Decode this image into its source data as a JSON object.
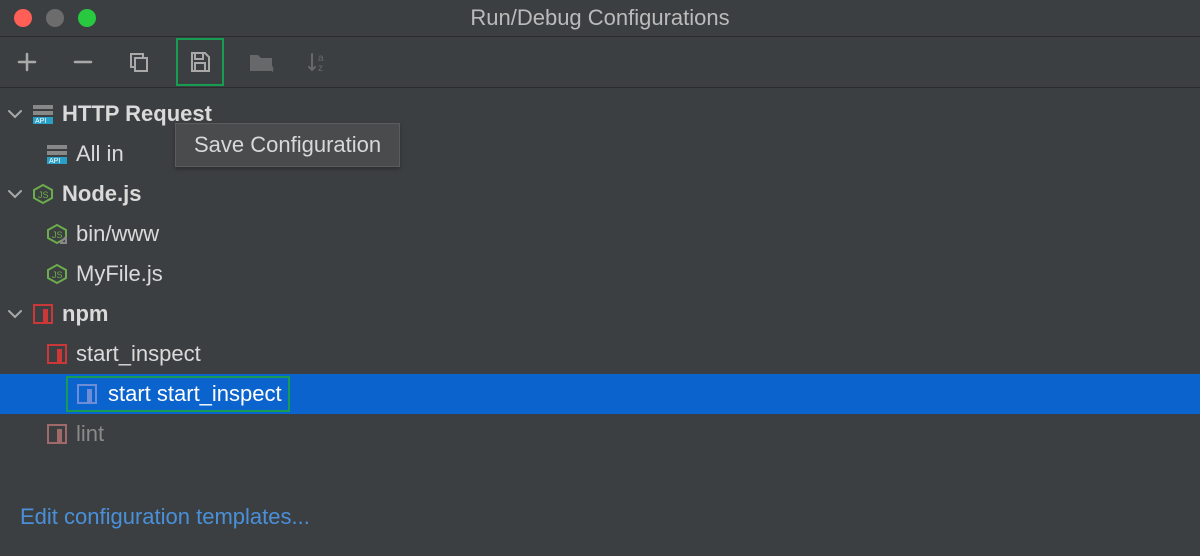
{
  "title": "Run/Debug Configurations",
  "tooltip": "Save Configuration",
  "link_text": "Edit configuration templates...",
  "tree": {
    "http": {
      "label": "HTTP Request",
      "child1": "All in"
    },
    "node": {
      "label": "Node.js",
      "child1": "bin/www",
      "child2": "MyFile.js"
    },
    "npm": {
      "label": "npm",
      "child1": "start_inspect",
      "child2": "start start_inspect",
      "child3": "lint"
    }
  }
}
